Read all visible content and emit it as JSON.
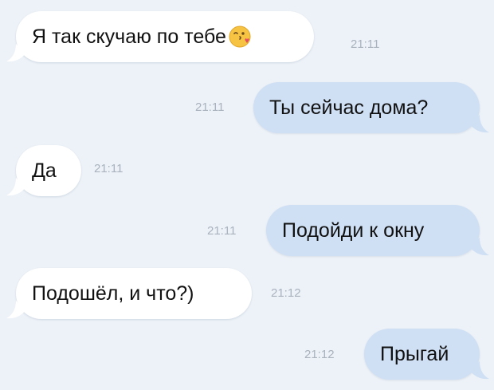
{
  "chat": {
    "messages": [
      {
        "id": "m1",
        "direction": "incoming",
        "text": "Я так скучаю по тебе",
        "emoji": "kissing-face-with-heart",
        "time": "21:11"
      },
      {
        "id": "m2",
        "direction": "outgoing",
        "text": "Ты сейчас дома?",
        "time": "21:11"
      },
      {
        "id": "m3",
        "direction": "incoming",
        "text": "Да",
        "time": "21:11"
      },
      {
        "id": "m4",
        "direction": "outgoing",
        "text": "Подойди к окну",
        "time": "21:11"
      },
      {
        "id": "m5",
        "direction": "incoming",
        "text": "Подошёл, и что?)",
        "time": "21:12"
      },
      {
        "id": "m6",
        "direction": "outgoing",
        "text": "Прыгай",
        "time": "21:12"
      }
    ]
  },
  "colors": {
    "background": "#edf2f8",
    "incoming_bubble": "#ffffff",
    "outgoing_bubble": "#cfdff4",
    "message_text": "#111111",
    "timestamp_text": "#a9b2bd"
  }
}
